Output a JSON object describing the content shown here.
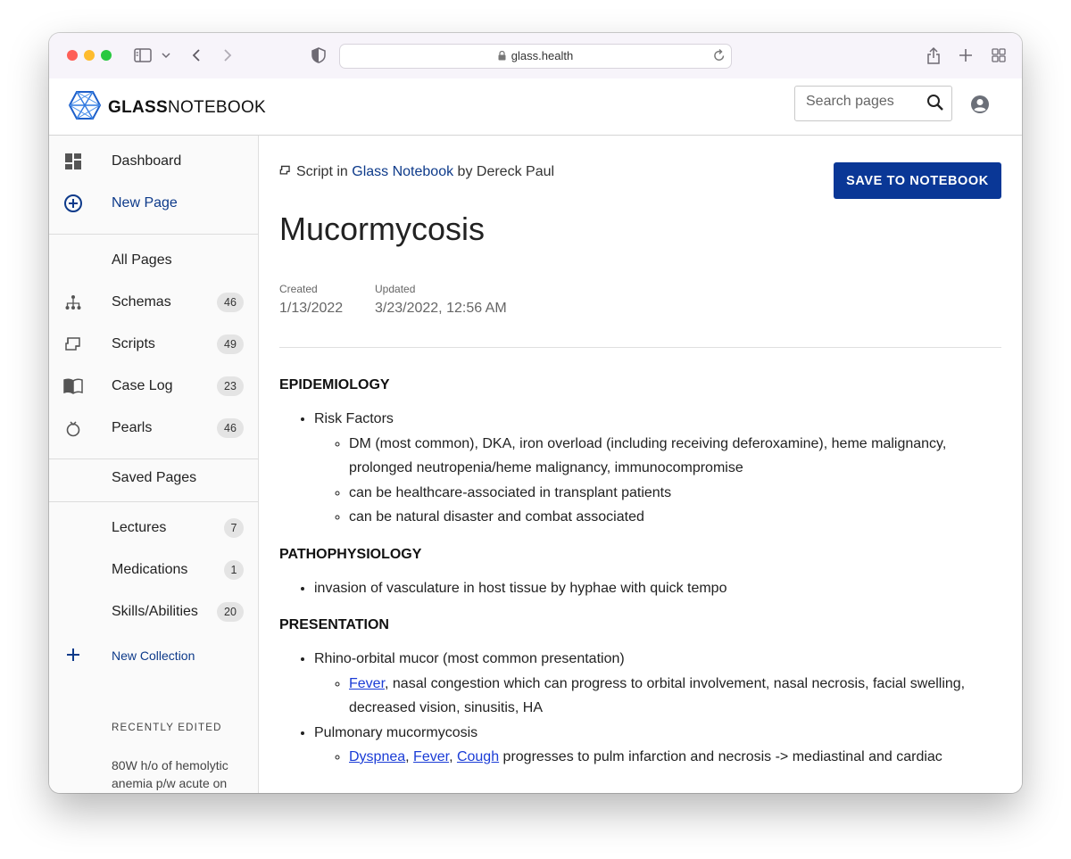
{
  "browser": {
    "url": "glass.health"
  },
  "header": {
    "logo_bold": "GLASS",
    "logo_light": "NOTEBOOK",
    "search_placeholder": "Search pages"
  },
  "sidebar": {
    "dashboard": "Dashboard",
    "new_page": "New Page",
    "all_pages": "All Pages",
    "schemas": {
      "label": "Schemas",
      "count": "46"
    },
    "scripts": {
      "label": "Scripts",
      "count": "49"
    },
    "case_log": {
      "label": "Case Log",
      "count": "23"
    },
    "pearls": {
      "label": "Pearls",
      "count": "46"
    },
    "saved_pages": "Saved Pages",
    "lectures": {
      "label": "Lectures",
      "count": "7"
    },
    "medications": {
      "label": "Medications",
      "count": "1"
    },
    "skills": {
      "label": "Skills/Abilities",
      "count": "20"
    },
    "new_collection": "New Collection",
    "recently_edited": "RECENTLY EDITED",
    "recent_item": "80W h/o of hemolytic anemia p/w acute on"
  },
  "page": {
    "byline_prefix": "Script in",
    "byline_link": "Glass Notebook",
    "byline_suffix": "by Dereck Paul",
    "save_button": "SAVE TO NOTEBOOK",
    "title": "Mucormycosis",
    "created_label": "Created",
    "created_value": "1/13/2022",
    "updated_label": "Updated",
    "updated_value": "3/23/2022, 12:56 AM"
  },
  "content": {
    "epidemiology": {
      "heading": "EPIDEMIOLOGY",
      "risk_factors": "Risk Factors",
      "rf1": "DM (most common), DKA, iron overload (including receiving deferoxamine), heme malignancy, prolonged neutropenia/heme malignancy, immunocompromise",
      "rf2": "can be healthcare-associated in transplant patients",
      "rf3": "can be natural disaster and combat associated"
    },
    "pathophysiology": {
      "heading": "PATHOPHYSIOLOGY",
      "p1": "invasion of vasculature in host tissue by hyphae with quick tempo"
    },
    "presentation": {
      "heading": "PRESENTATION",
      "rhino": "Rhino-orbital mucor (most common presentation)",
      "rhino_link": "Fever",
      "rhino_rest": ", nasal congestion which can progress to orbital involvement, nasal necrosis, facial swelling, decreased vision, sinusitis, HA",
      "pulm": "Pulmonary mucormycosis",
      "pulm_link1": "Dyspnea",
      "sep1": ", ",
      "pulm_link2": "Fever",
      "sep2": ", ",
      "pulm_link3": "Cough",
      "pulm_rest": " progresses to pulm infarction and necrosis -> mediastinal and cardiac"
    }
  },
  "colors": {
    "primary": "#0a3796",
    "link": "#1a3cd6",
    "nav_blue": "#0d3a8a"
  }
}
